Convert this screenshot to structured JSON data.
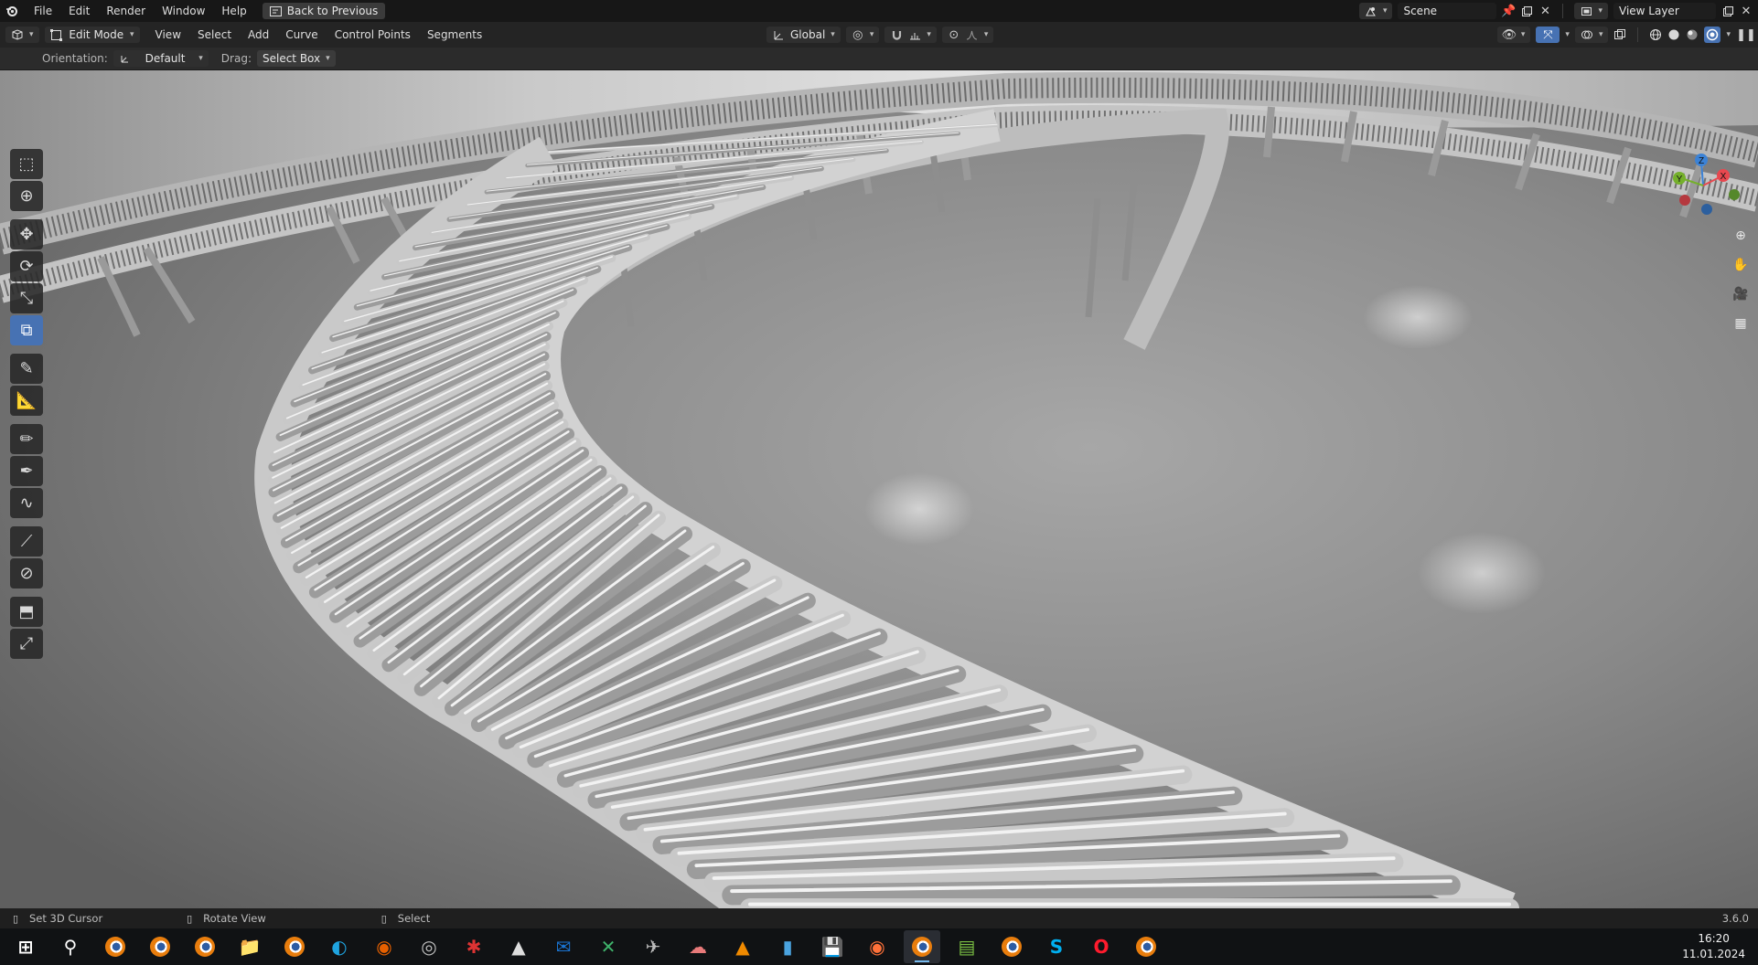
{
  "menubar": {
    "items": [
      "File",
      "Edit",
      "Render",
      "Window",
      "Help"
    ],
    "back_button": "Back to Previous",
    "scene_label": "Scene",
    "view_layer_label": "View Layer"
  },
  "header": {
    "mode": "Edit Mode",
    "menus": [
      "View",
      "Select",
      "Add",
      "Curve",
      "Control Points",
      "Segments"
    ],
    "transform_orientation": "Global"
  },
  "tool_settings": {
    "orientation_label": "Orientation:",
    "orientation_value": "Default",
    "drag_label": "Drag:",
    "drag_value": "Select Box"
  },
  "toolbar": {
    "tools": [
      {
        "name": "select-box-tool",
        "icon": "select-box-icon",
        "active": false
      },
      {
        "name": "cursor-tool",
        "icon": "cursor-icon",
        "active": false
      },
      {
        "name": "move-tool",
        "icon": "move-icon",
        "active": false
      },
      {
        "name": "rotate-tool",
        "icon": "rotate-icon",
        "active": false
      },
      {
        "name": "scale-tool",
        "icon": "scale-icon",
        "active": false
      },
      {
        "name": "transform-tool",
        "icon": "transform-icon",
        "active": true
      },
      {
        "name": "annotate-tool",
        "icon": "annotate-icon",
        "active": false
      },
      {
        "name": "measure-tool",
        "icon": "measure-icon",
        "active": false
      },
      {
        "name": "draw-tool",
        "icon": "draw-icon",
        "active": false
      },
      {
        "name": "pen-tool",
        "icon": "pen-icon",
        "active": false
      },
      {
        "name": "curve-tool",
        "icon": "curve-icon",
        "active": false
      },
      {
        "name": "tilt-tool",
        "icon": "tilt-icon",
        "active": false
      },
      {
        "name": "radius-tool",
        "icon": "radius-icon",
        "active": false
      },
      {
        "name": "extrude-tool",
        "icon": "extrude-icon",
        "active": false
      },
      {
        "name": "randomize-tool",
        "icon": "randomize-icon",
        "active": false
      }
    ]
  },
  "gizmo": {
    "z": "Z",
    "y": "Y",
    "x": "X"
  },
  "statusbar": {
    "left_hint": "Set 3D Cursor",
    "middle_hint": "Rotate View",
    "right_hint": "Select",
    "version": "3.6.0"
  },
  "taskbar": {
    "apps": [
      "windows-start-icon",
      "search-icon",
      "blender-icon",
      "blender-icon",
      "blender-icon",
      "file-explorer-icon",
      "blender-icon",
      "edge-icon",
      "firefox-dev-icon",
      "aperture-icon",
      "red-bug-icon",
      "inkscape-icon",
      "outlook-icon",
      "excel-icon",
      "drone-icon",
      "cloud-app-icon",
      "vlc-icon",
      "blue-app-icon",
      "floppy-icon",
      "firefox-icon",
      "blender-icon",
      "spreadsheet-icon",
      "blender-icon",
      "skype-icon",
      "opera-icon",
      "blender-icon"
    ],
    "time": "16:20",
    "date": "11.01.2024"
  },
  "colors": {
    "accent": "#4772b3",
    "axis_x": "#e8484f",
    "axis_y": "#75b02c",
    "axis_z": "#3b82d6"
  }
}
